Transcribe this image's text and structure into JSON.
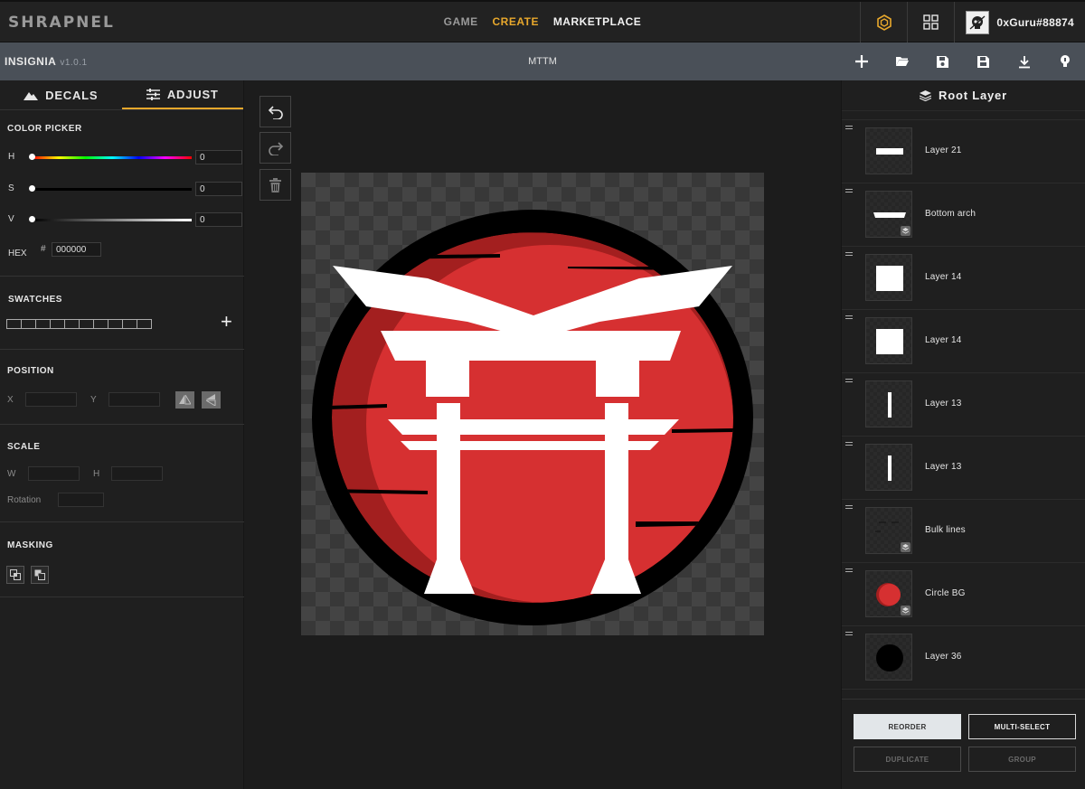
{
  "topnav": {
    "logo": "SHRAPNEL",
    "links": {
      "game": "GAME",
      "create": "CREATE",
      "marketplace": "MARKETPLACE"
    },
    "username": "0xGuru#88874",
    "icons": [
      "shrapnel-token-icon",
      "grid-apps-icon",
      "avatar"
    ]
  },
  "toolbar": {
    "app_name": "INSIGNIA",
    "app_version": "v1.0.1",
    "document_name": "MTTM",
    "icons": [
      "plus-icon",
      "folder-open-icon",
      "save-icon",
      "save-as-icon",
      "download-icon",
      "lightbulb-icon"
    ]
  },
  "left_panel": {
    "tabs": {
      "decals": "DECALS",
      "adjust": "ADJUST"
    },
    "color_picker": {
      "title": "COLOR PICKER",
      "h_label": "H",
      "h_value": "0",
      "s_label": "S",
      "s_value": "0",
      "v_label": "V",
      "v_value": "0",
      "hex_label": "HEX",
      "hex_hash": "#",
      "hex_value": "000000"
    },
    "swatches": {
      "title": "SWATCHES",
      "count": 10
    },
    "position": {
      "title": "POSITION",
      "x_label": "X",
      "y_label": "Y"
    },
    "scale": {
      "title": "SCALE",
      "w_label": "W",
      "h_label": "H",
      "rotation_label": "Rotation"
    },
    "masking": {
      "title": "MASKING"
    }
  },
  "right_panel": {
    "title": "Root Layer",
    "layers": [
      {
        "name": "Layer 21",
        "thumb": "bar"
      },
      {
        "name": "Bottom arch",
        "thumb": "arch",
        "group": true
      },
      {
        "name": "Layer 14",
        "thumb": "square"
      },
      {
        "name": "Layer 14",
        "thumb": "square"
      },
      {
        "name": "Layer 13",
        "thumb": "line"
      },
      {
        "name": "Layer 13",
        "thumb": "line"
      },
      {
        "name": "Bulk lines",
        "thumb": "dashes",
        "group": true
      },
      {
        "name": "Circle BG",
        "thumb": "red-circle",
        "group": true
      },
      {
        "name": "Layer 36",
        "thumb": "black-circle"
      }
    ],
    "buttons": {
      "reorder": "REORDER",
      "multi_select": "MULTI-SELECT",
      "duplicate": "DUPLICATE",
      "group": "GROUP"
    }
  },
  "colors": {
    "accent": "#e8a82c",
    "emblem_red": "#d63031",
    "emblem_dark_red": "#a31f1f",
    "emblem_black": "#000000",
    "emblem_white": "#ffffff"
  }
}
